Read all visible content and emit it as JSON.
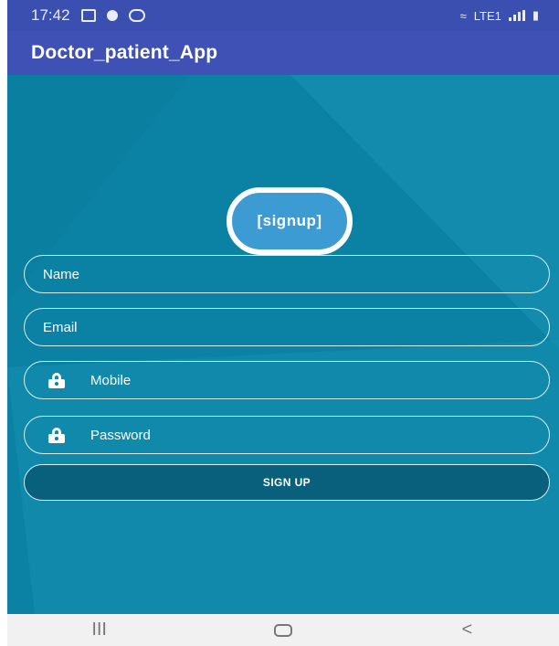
{
  "status_bar": {
    "time": "17:42",
    "network_label": "LTE1"
  },
  "app_bar": {
    "title": "Doctor_patient_App"
  },
  "logo": {
    "text": "[signup]"
  },
  "form": {
    "name_label": "Name",
    "email_label": "Email",
    "mobile_label": "Mobile",
    "password_label": "Password",
    "submit_label": "SIGN UP"
  },
  "nav_bar": {
    "recents_glyph": "III",
    "back_glyph": "<"
  },
  "colors": {
    "app_bar": "#3f51b5",
    "status_bar": "#3a4fb0",
    "background": "#0b82a3",
    "button": "#08607c",
    "logo": "#3c9bd2"
  },
  "icons": {
    "mobile": "lock-icon",
    "password": "lock-icon"
  }
}
